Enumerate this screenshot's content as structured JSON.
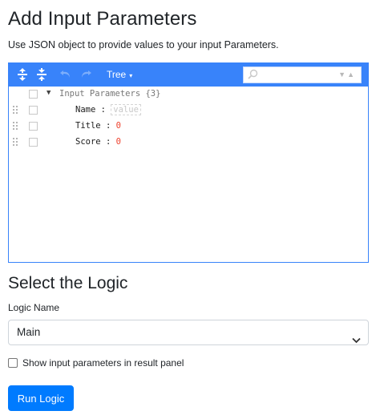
{
  "header": {
    "title": "Add Input Parameters",
    "subtitle": "Use JSON object to provide values to your input Parameters."
  },
  "editor": {
    "toolbar": {
      "mode_label": "Tree",
      "buttons": [
        "expand-all-icon",
        "collapse-all-icon",
        "undo-icon",
        "redo-icon"
      ],
      "search_placeholder": ""
    },
    "root": {
      "label": "Input Parameters",
      "count": "{3}"
    },
    "fields": [
      {
        "key": "Name",
        "colon": ":",
        "value": "value",
        "placeholder": true
      },
      {
        "key": "Title",
        "colon": ":",
        "value": "0",
        "placeholder": false
      },
      {
        "key": "Score",
        "colon": ":",
        "value": "0",
        "placeholder": false
      }
    ]
  },
  "logic": {
    "section_title": "Select the Logic",
    "name_label": "Logic Name",
    "selected": "Main",
    "checkbox_label": "Show input parameters in result panel",
    "checkbox_checked": false,
    "run_button": "Run Logic"
  },
  "colors": {
    "accent": "#3883fa",
    "button": "#007bff",
    "number": "#ee422e"
  }
}
